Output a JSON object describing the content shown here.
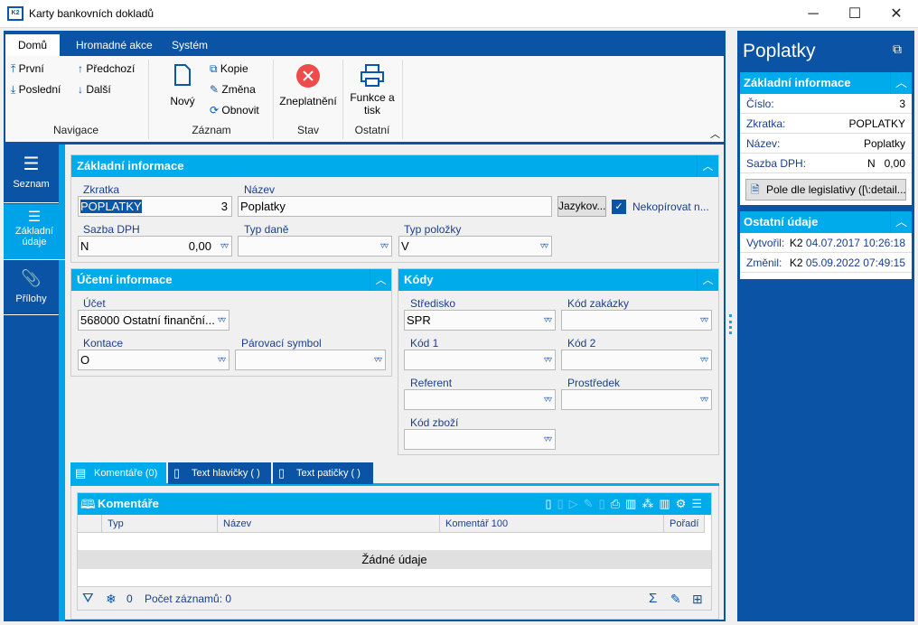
{
  "window": {
    "title": "Karty bankovních dokladů",
    "logo": "K2",
    "minimize": "─",
    "maximize": "☐",
    "close": "✕"
  },
  "ribbon": {
    "tabs": [
      "Domů",
      "Hromadné akce",
      "Systém"
    ],
    "navigace": {
      "first": "První",
      "last": "Poslední",
      "prev": "Předchozí",
      "next": "Další",
      "label": "Navigace"
    },
    "zaznam": {
      "new": "Nový",
      "copy": "Kopie",
      "edit": "Změna",
      "refresh": "Obnovit",
      "label": "Záznam"
    },
    "stav": {
      "cancel": "Zneplatnění",
      "label": "Stav"
    },
    "ostatni": {
      "print1": "Funkce a",
      "print2": "tisk",
      "label": "Ostatní"
    }
  },
  "nav": {
    "items": [
      "Seznam",
      "Základní",
      "údaje",
      "Přílohy"
    ]
  },
  "zakladni": {
    "title": "Základní informace",
    "zkratka_label": "Zkratka",
    "zkratka": "POPLATKY",
    "cislo": "3",
    "nazev_label": "Název",
    "nazev": "Poplatky",
    "jazyk_button": "Jazykov...",
    "nekop_label": "Nekopírovat n...",
    "sazba_label": "Sazba DPH",
    "sazba_code": "N",
    "sazba_value": "0,00",
    "typdane_label": "Typ daně",
    "typdane": "",
    "typpol_label": "Typ položky",
    "typpol": "V"
  },
  "ucetni": {
    "title": "Účetní informace",
    "ucet_label": "Účet",
    "ucet": "568000 Ostatní finanční...",
    "kontace_label": "Kontace",
    "kontace": "O",
    "parsym_label": "Párovací symbol",
    "parsym": ""
  },
  "kody": {
    "title": "Kódy",
    "stredisko_label": "Středisko",
    "stredisko": "SPR",
    "zakazka_label": "Kód zakázky",
    "kod1_label": "Kód 1",
    "kod2_label": "Kód 2",
    "referent_label": "Referent",
    "prostredek_label": "Prostředek",
    "zbozi_label": "Kód zboží"
  },
  "bottom_tabs": [
    "Komentáře (0)",
    "Text hlavičky ( )",
    "Text patičky ( )"
  ],
  "grid": {
    "title": "Komentáře",
    "columns": [
      "Typ",
      "Název",
      "Komentář 100",
      "Pořadí"
    ],
    "empty": "Žádné údaje",
    "filter_count": "0",
    "record_count": "Počet záznamů: 0",
    "sum": "Σ"
  },
  "right": {
    "title": "Poplatky",
    "sec1": "Základní informace",
    "rows": [
      {
        "k": "Číslo:",
        "v": "3"
      },
      {
        "k": "Zkratka:",
        "v": "POPLATKY"
      },
      {
        "k": "Název:",
        "v": "Poplatky"
      },
      {
        "k": "Sazba DPH:",
        "v": "N   0,00"
      }
    ],
    "legis_button": "Pole dle legislativy ([\\:detail...",
    "sec2": "Ostatní údaje",
    "created_label": "Vytvořil:",
    "created_user": "K2",
    "created": "04.07.2017 10:26:18",
    "changed_label": "Změnil:",
    "changed_user": "K2",
    "changed": "05.09.2022 07:49:15"
  }
}
